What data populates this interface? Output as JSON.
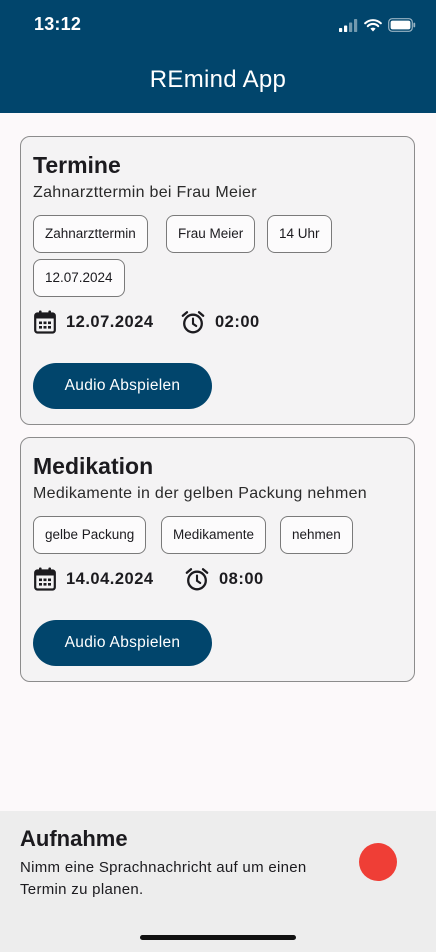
{
  "status_bar": {
    "time": "13:12"
  },
  "appbar": {
    "title": "REmind App"
  },
  "cards": [
    {
      "title": "Termine",
      "description": "Zahnarzttermin bei Frau Meier",
      "chips": [
        "Zahnarzttermin",
        "Frau Meier",
        "14 Uhr",
        "12.07.2024"
      ],
      "date": "12.07.2024",
      "time": "02:00",
      "button_label": "Audio Abspielen"
    },
    {
      "title": "Medikation",
      "description": "Medikamente in der gelben Packung nehmen",
      "chips": [
        "gelbe Packung",
        "Medikamente",
        "nehmen"
      ],
      "date": "14.04.2024",
      "time": "08:00",
      "button_label": "Audio Abspielen"
    }
  ],
  "recording": {
    "title": "Aufnahme",
    "description": "Nimm eine Sprachnachricht auf um einen Termin zu planen."
  },
  "colors": {
    "primary": "#01456c",
    "record": "#ef3e36",
    "card_bg": "#f4f3f4",
    "sheet_bg": "#ededed"
  },
  "icons": {
    "status": [
      "cellular-signal-icon",
      "wifi-icon",
      "battery-icon"
    ],
    "meta": [
      "calendar-icon",
      "alarm-clock-icon"
    ]
  }
}
